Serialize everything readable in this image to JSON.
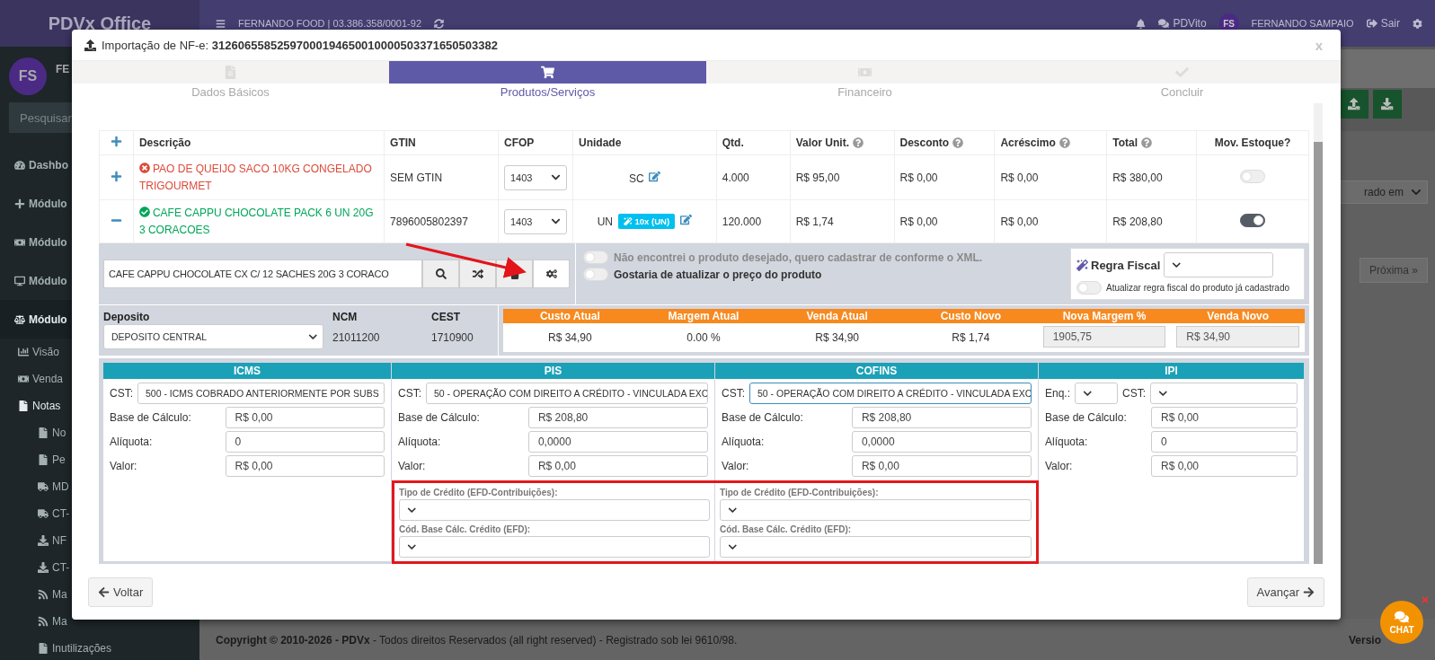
{
  "topbar": {
    "brand": "PDVx Office",
    "company": "FERNANDO FOOD | 03.386.358/0001-92",
    "assistant": "PDVito",
    "user_initials": "FS",
    "user_name": "FERNANDO SAMPAIO",
    "logout": "Sair"
  },
  "sidebar": {
    "avatar": "FS",
    "user_name": "FE",
    "search_placeholder": "Pesquisar",
    "items": [
      {
        "label": "Dashbo",
        "expanded": false
      },
      {
        "label": "Módulo",
        "expanded": false
      },
      {
        "label": "Módulo",
        "expanded": false
      },
      {
        "label": "Módulo",
        "expanded": false
      },
      {
        "label": "Módulo",
        "expanded": true,
        "children": [
          {
            "label": "Visão",
            "expanded": false
          },
          {
            "label": "Venda",
            "expanded": false
          },
          {
            "label": "Notas",
            "expanded": true,
            "children": [
              {
                "label": "No"
              },
              {
                "label": "Pe"
              },
              {
                "label": "MD"
              },
              {
                "label": "CT-"
              },
              {
                "label": "NF"
              },
              {
                "label": "CT-"
              },
              {
                "label": "Ma"
              },
              {
                "label": "Ma"
              },
              {
                "label": "Inutilizações"
              }
            ]
          }
        ]
      }
    ]
  },
  "background": {
    "filter_select": "rado em",
    "next_page": "Próxima »",
    "footer": "**Copyright © 2010-2026 - PDVx** - Todos direitos Reservados (all right reserved) - Registrado sob lei 9610/98.",
    "version": "Versio"
  },
  "modal": {
    "title": "Importação de NF-e: **31260655852597000194650010000503371650503382**",
    "close": "x",
    "steps": [
      {
        "label": "Dados Básicos",
        "selected": false
      },
      {
        "label": "Produtos/Serviços",
        "selected": true
      },
      {
        "label": "Financeiro",
        "selected": false
      },
      {
        "label": "Concluir",
        "selected": false
      }
    ],
    "items": {
      "columns": [
        {
          "label": "Descrição",
          "help": false
        },
        {
          "label": "GTIN",
          "help": false
        },
        {
          "label": "CFOP",
          "help": false
        },
        {
          "label": "Unidade",
          "help": false
        },
        {
          "label": "Qtd.",
          "help": false
        },
        {
          "label": "Valor Unit.",
          "help": true
        },
        {
          "label": "Desconto",
          "help": true
        },
        {
          "label": "Acréscimo",
          "help": true
        },
        {
          "label": "Total",
          "help": true
        },
        {
          "label": "Mov. Estoque?",
          "help": false
        }
      ],
      "rows": [
        {
          "expanded": false,
          "valid": false,
          "description": "PAO DE QUEIJO SACO 10KG CONGELADO TRIGOURMET",
          "gtin": "SEM GTIN",
          "cfop": "1403",
          "unit": "SC",
          "qty": "4.000",
          "unit_price": "R$ 95,00",
          "discount": "R$ 0,00",
          "surcharge": "R$ 0,00",
          "total": "R$ 380,00",
          "stock_move": false
        },
        {
          "expanded": true,
          "valid": true,
          "description": "CAFE CAPPU CHOCOLATE PACK 6 UN 20G 3 CORACOES",
          "gtin": "7896005802397",
          "cfop": "1403",
          "unit": "UN",
          "unit_badge": "10x (UN)",
          "qty": "120.000",
          "unit_price": "R$ 1,74",
          "discount": "R$ 0,00",
          "surcharge": "R$ 0,00",
          "total": "R$ 208,80",
          "stock_move": true
        }
      ]
    },
    "detail": {
      "product_search": "CAFE CAPPU CHOCOLATE CX C/ 12 SACHES 20G 3 CORACO",
      "options": [
        {
          "label": "Não encontrei o produto desejado, quero cadastrar de conforme o XML.",
          "on": false,
          "disabled": true
        },
        {
          "label": "Gostaria de atualizar o preço do produto",
          "on": false,
          "disabled": false
        }
      ],
      "fiscal_rule": {
        "label": "Regra Fiscal",
        "toggle_label": "Atualizar regra fiscal do produto já cadastrado",
        "on": false
      }
    },
    "stock": {
      "deposit_label": "Deposito",
      "deposit": "DEPOSITO CENTRAL",
      "ncm_label": "NCM",
      "ncm": "21011200",
      "cest_label": "CEST",
      "cest": "1710900"
    },
    "pricing": {
      "columns": [
        "Custo Atual",
        "Margem Atual",
        "Venda Atual",
        "Custo Novo",
        "Nova Margem %",
        "Venda Novo"
      ],
      "values": [
        {
          "kind": "text",
          "value": "R$ 34,90"
        },
        {
          "kind": "text",
          "value": "0.00 %"
        },
        {
          "kind": "text",
          "value": "R$ 34,90"
        },
        {
          "kind": "text",
          "value": "R$ 1,74"
        },
        {
          "kind": "input",
          "value": "1905,75"
        },
        {
          "kind": "input",
          "value": "R$ 34,90"
        }
      ]
    },
    "taxes": [
      {
        "title": "ICMS",
        "cst_label": "CST:",
        "cst": "500 - ICMS COBRADO ANTERIORMENTE POR SUBS",
        "focused": false,
        "fields": [
          {
            "label": "Base de Cálculo:",
            "value": "R$ 0,00"
          },
          {
            "label": "Alíquota:",
            "value": "0"
          },
          {
            "label": "Valor:",
            "value": "R$ 0,00"
          }
        ]
      },
      {
        "title": "PIS",
        "cst_label": "CST:",
        "cst": "50 - OPERAÇÃO COM DIREITO A CRÉDITO - VINCULADA EXC",
        "focused": false,
        "fields": [
          {
            "label": "Base de Cálculo:",
            "value": "R$ 208,80"
          },
          {
            "label": "Alíquota:",
            "value": "0,0000"
          },
          {
            "label": "Valor:",
            "value": "R$ 0,00"
          }
        ],
        "credit": [
          {
            "label": "Tipo de Crédito (EFD-Contribuições):"
          },
          {
            "label": "Cód. Base Cálc. Crédito (EFD):"
          }
        ]
      },
      {
        "title": "COFINS",
        "cst_label": "CST:",
        "cst": "50 - OPERAÇÃO COM DIREITO A CRÉDITO - VINCULADA EXC",
        "focused": true,
        "fields": [
          {
            "label": "Base de Cálculo:",
            "value": "R$ 208,80"
          },
          {
            "label": "Alíquota:",
            "value": "0,0000"
          },
          {
            "label": "Valor:",
            "value": "R$ 0,00"
          }
        ],
        "credit": [
          {
            "label": "Tipo de Crédito (EFD-Contribuições):"
          },
          {
            "label": "Cód. Base Cálc. Crédito (EFD):"
          }
        ]
      },
      {
        "title": "IPI",
        "enq_label": "Enq.:",
        "cst_label": "CST:",
        "focused": false,
        "fields": [
          {
            "label": "Base de Cálculo:",
            "value": "R$ 0,00"
          },
          {
            "label": "Alíquota:",
            "value": "0"
          },
          {
            "label": "Valor:",
            "value": "R$ 0,00"
          }
        ]
      }
    ],
    "back": "Voltar",
    "next": "Avançar"
  },
  "chat": {
    "label": "CHAT"
  }
}
